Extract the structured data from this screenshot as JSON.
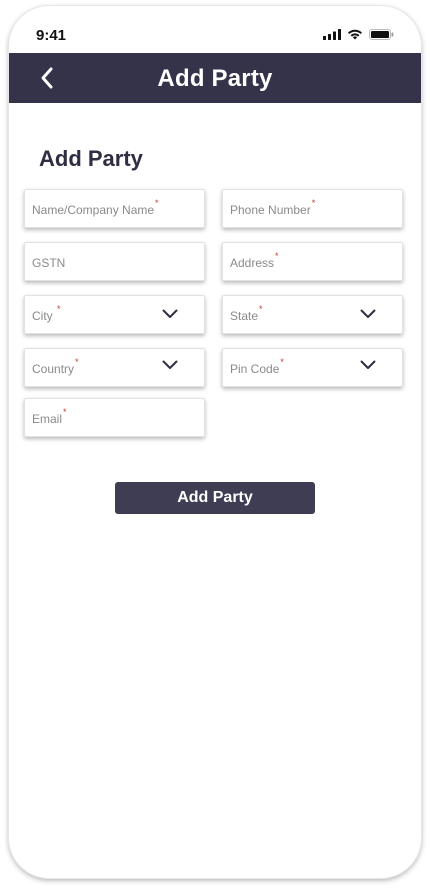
{
  "status_bar": {
    "time": "9:41",
    "icons": [
      "cellular-signal-icon",
      "wifi-icon",
      "battery-icon"
    ]
  },
  "app_bar": {
    "back_icon": "chevron-left-icon",
    "title": "Add Party",
    "background": "#35334a"
  },
  "form": {
    "heading": "Add Party",
    "required_marker": "*",
    "fields": {
      "name": {
        "label": "Name/Company Name",
        "required": true,
        "type": "text"
      },
      "phone": {
        "label": "Phone Number",
        "required": true,
        "type": "text"
      },
      "gstn": {
        "label": "GSTN",
        "required": false,
        "type": "text"
      },
      "address": {
        "label": "Address",
        "required": true,
        "type": "text"
      },
      "city": {
        "label": "City",
        "required": true,
        "type": "dropdown"
      },
      "state": {
        "label": "State",
        "required": true,
        "type": "dropdown"
      },
      "country": {
        "label": "Country",
        "required": true,
        "type": "dropdown"
      },
      "pincode": {
        "label": "Pin Code",
        "required": true,
        "type": "dropdown"
      },
      "email": {
        "label": "Email",
        "required": true,
        "type": "text"
      }
    },
    "submit_label": "Add Party",
    "accent": "#3f3d54",
    "required_color": "#c0392b"
  }
}
